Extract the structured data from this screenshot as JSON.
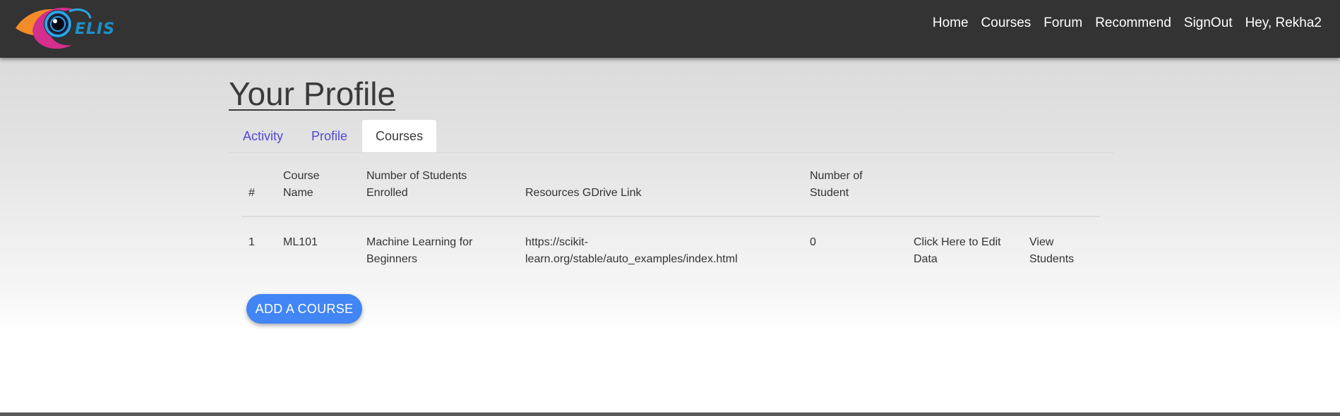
{
  "brand": {
    "logo_text": "ELIS",
    "colors": {
      "navbar": "#333333",
      "accent": "#4285f4",
      "tab_link": "#5546d8"
    }
  },
  "nav": {
    "items": [
      {
        "label": "Home"
      },
      {
        "label": "Courses"
      },
      {
        "label": "Forum"
      },
      {
        "label": "Recommend"
      },
      {
        "label": "SignOut"
      },
      {
        "label": "Hey, Rekha2"
      }
    ]
  },
  "page": {
    "title": "Your Profile"
  },
  "tabs": [
    {
      "label": "Activity",
      "active": false
    },
    {
      "label": "Profile",
      "active": false
    },
    {
      "label": "Courses",
      "active": true
    }
  ],
  "table": {
    "headers": [
      "#",
      "Course Name",
      "Number of Students Enrolled",
      "Resources GDrive Link",
      "Number of Student",
      "",
      ""
    ],
    "rows": [
      {
        "index": "1",
        "course_name": "ML101",
        "enrolled": "Machine Learning for Beginners",
        "gdrive_link": "https://scikit-learn.org/stable/auto_examples/index.html",
        "num_students": "0",
        "edit_action": "Click Here to Edit Data",
        "view_action": "View Students"
      }
    ]
  },
  "actions": {
    "add_course_label": "ADD A COURSE"
  }
}
